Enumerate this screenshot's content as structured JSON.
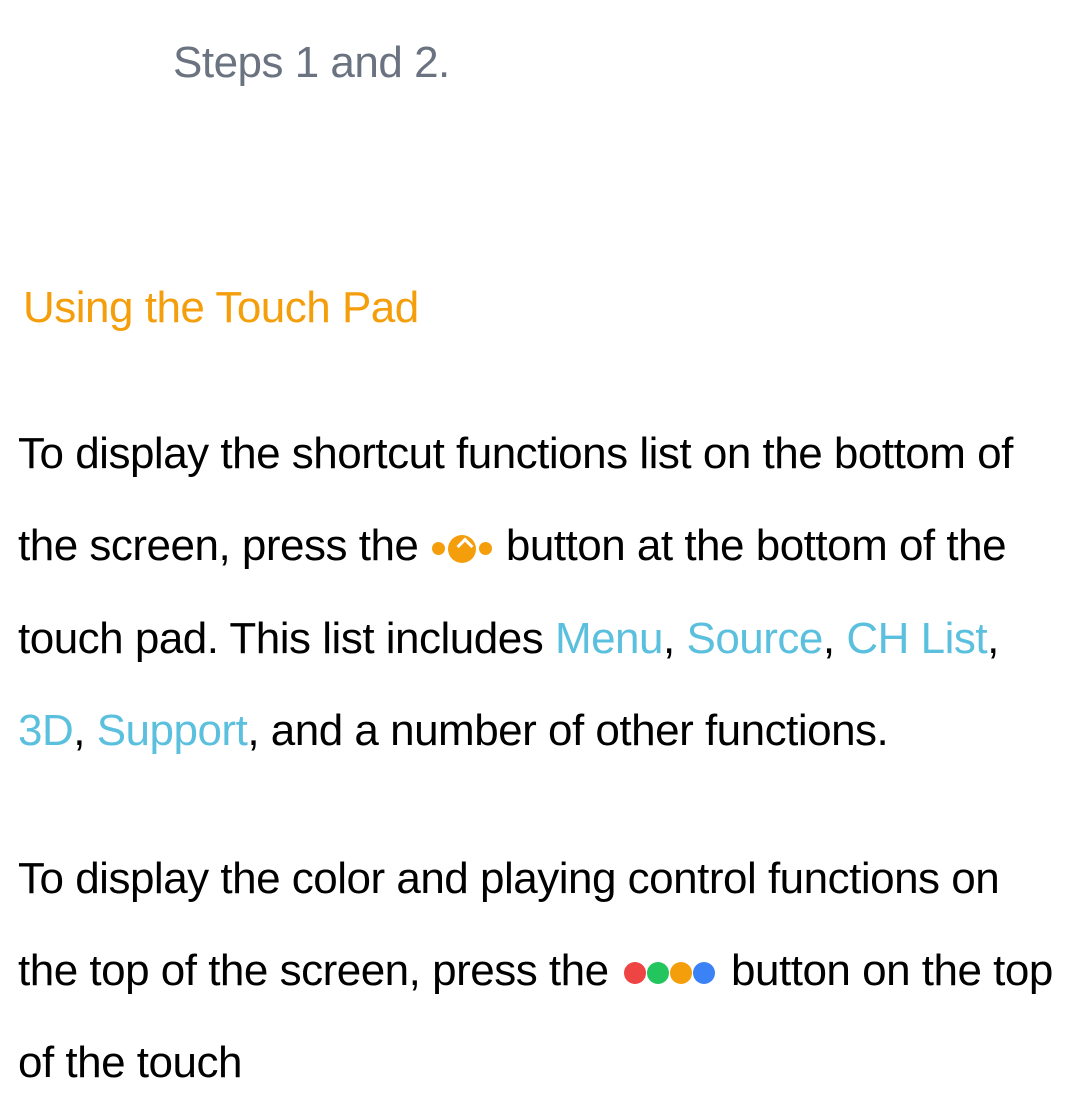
{
  "steps_text": "Steps 1 and 2.",
  "heading": "Using the Touch Pad",
  "para1": {
    "seg1": "To display the shortcut functions list on the bottom of the screen, press the ",
    "seg2": " button at the bottom of the touch pad. This list includes ",
    "link_menu": "Menu",
    "comma1": ", ",
    "link_source": "Source",
    "comma2": ", ",
    "link_chlist": "CH List",
    "comma3": ", ",
    "link_3d": "3D",
    "comma4": ", ",
    "link_support": "Support",
    "seg3": ", and a number of other functions."
  },
  "para2": {
    "seg1": "To display the color and playing control functions on the top of the screen, press the ",
    "seg2": " button on the top of the touch"
  }
}
